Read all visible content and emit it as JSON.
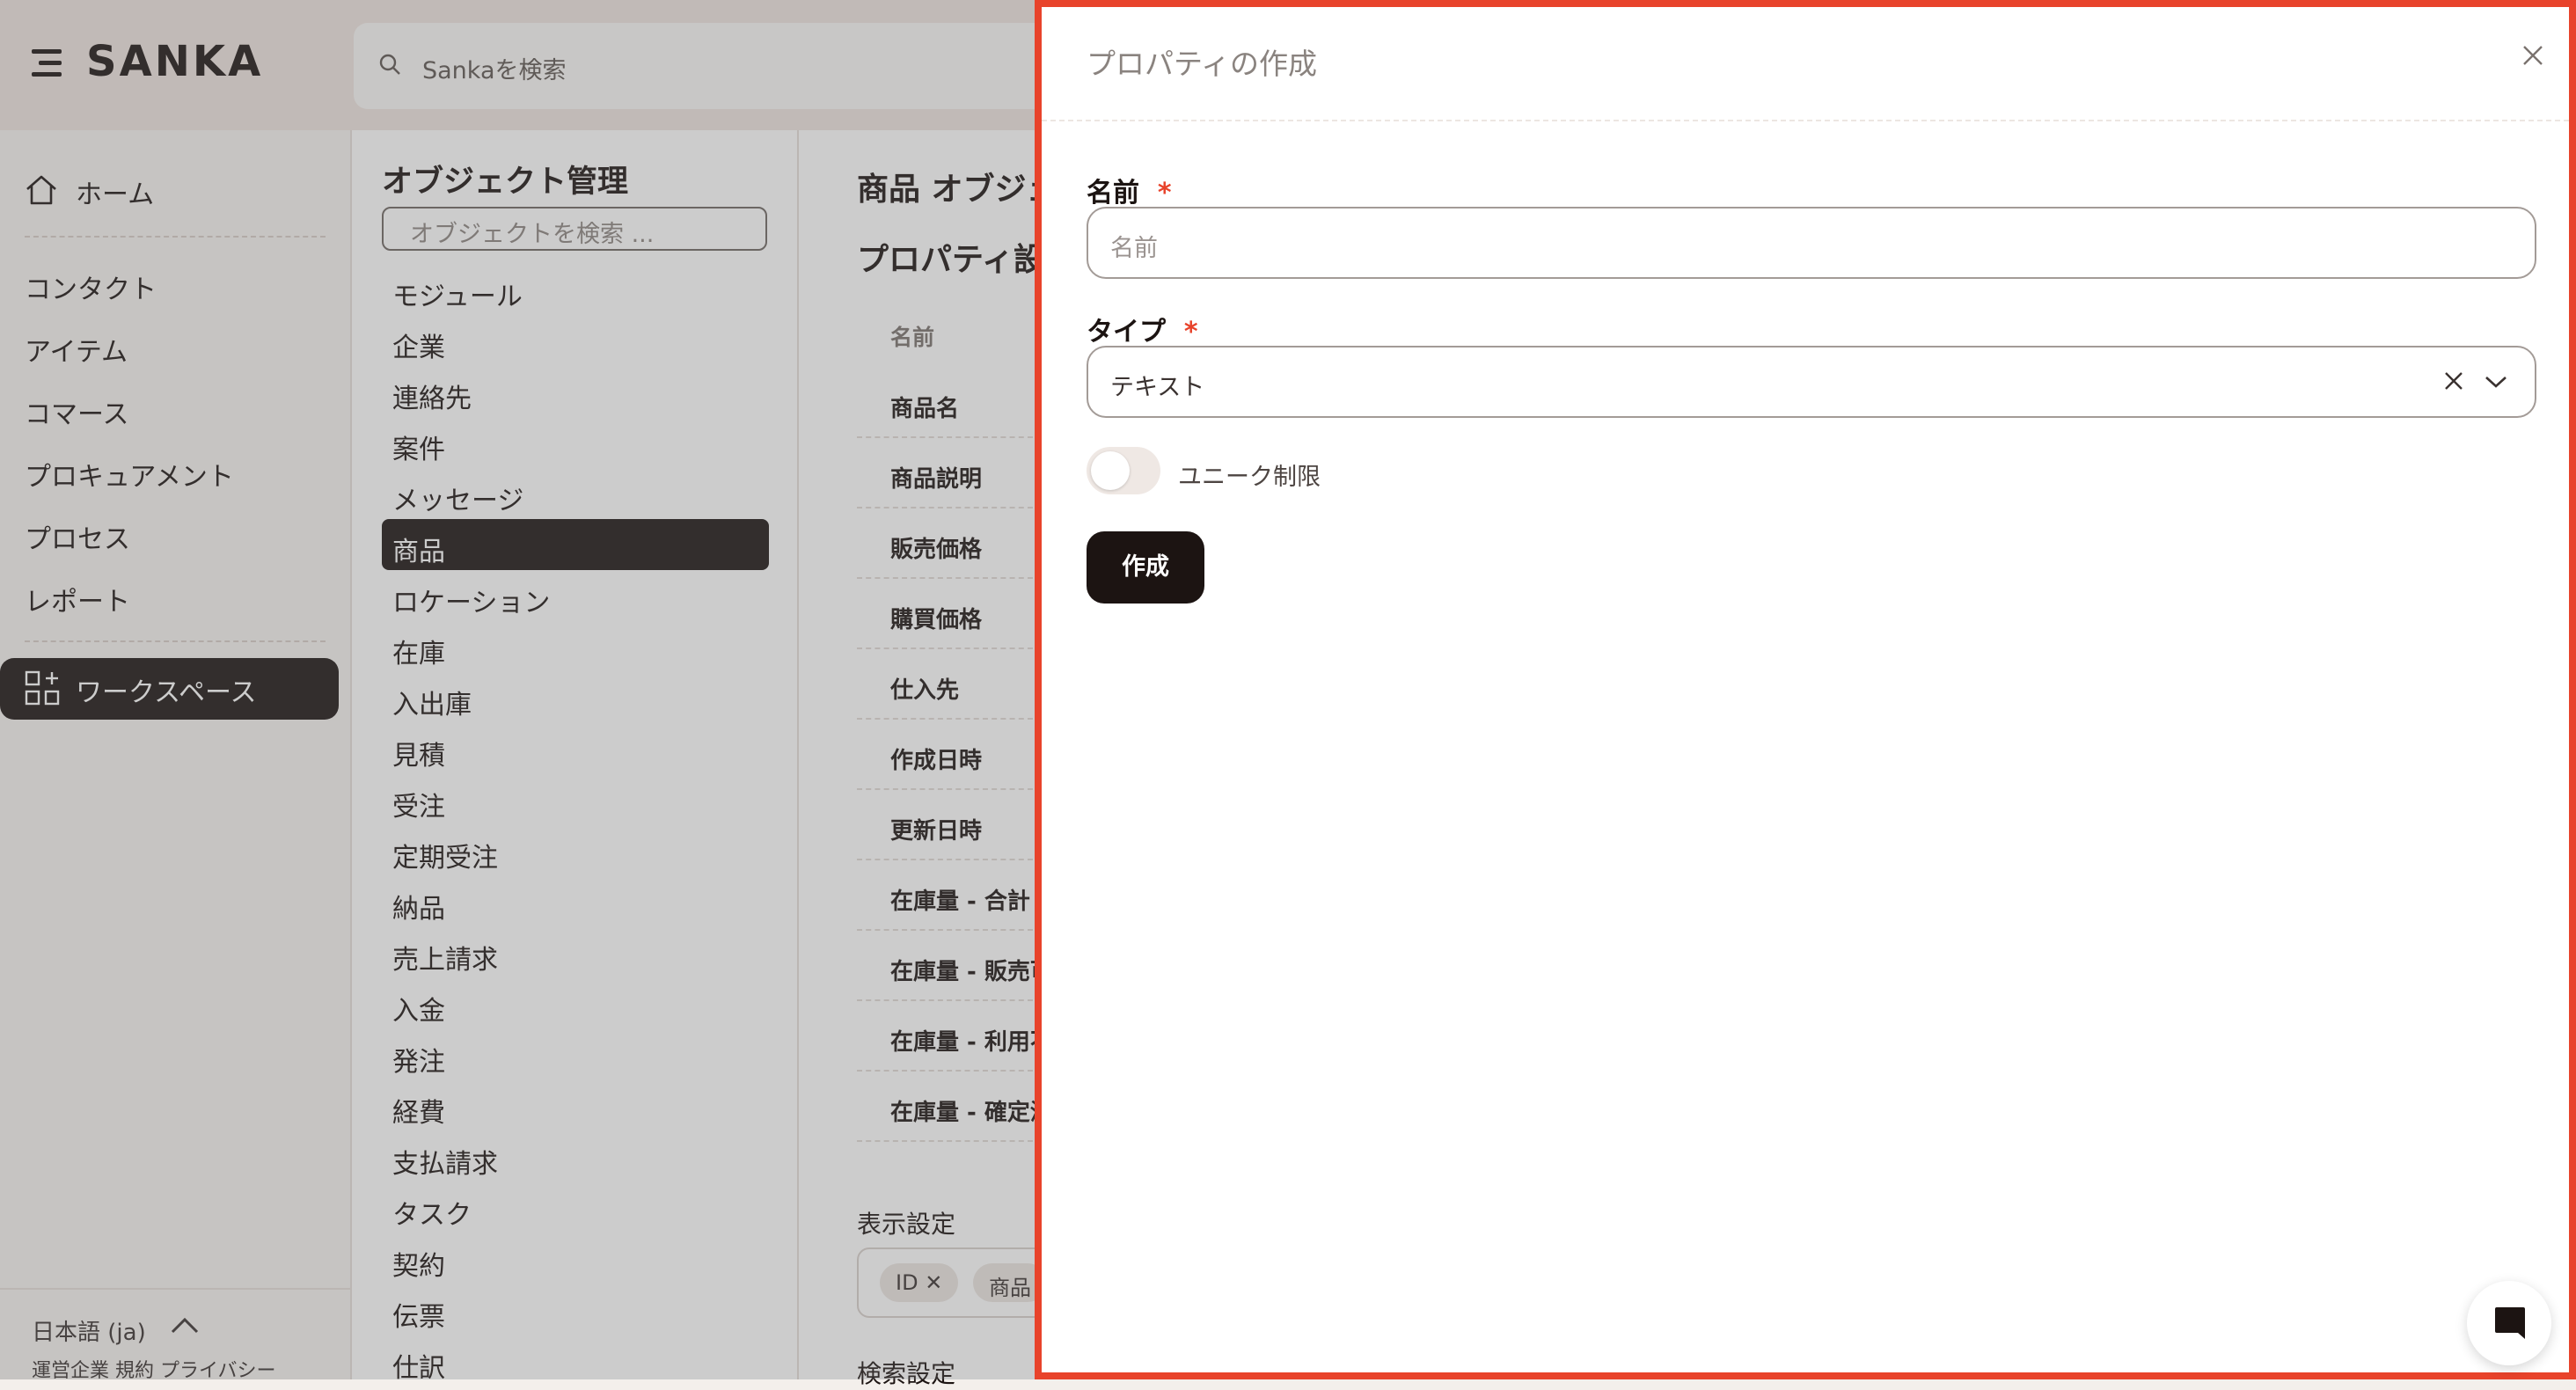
{
  "header": {
    "logo_text": "SANKA",
    "search_placeholder": "Sankaを検索"
  },
  "sidebar": {
    "home": "ホーム",
    "items": [
      "コンタクト",
      "アイテム",
      "コマース",
      "プロキュアメント",
      "プロセス",
      "レポート"
    ],
    "workspace": "ワークスペース",
    "language": "日本語 (ja)",
    "footer_links": "運営企業 規約 プライバシー"
  },
  "objects": {
    "title": "オブジェクト管理",
    "search_placeholder": "オブジェクトを検索 ...",
    "items": [
      "モジュール",
      "企業",
      "連絡先",
      "案件",
      "メッセージ",
      "商品",
      "ロケーション",
      "在庫",
      "入出庫",
      "見積",
      "受注",
      "定期受注",
      "納品",
      "売上請求",
      "入金",
      "発注",
      "経費",
      "支払請求",
      "タスク",
      "契約",
      "伝票",
      "仕訳"
    ],
    "active_index": 5
  },
  "main": {
    "title": "商品 オブジェ",
    "section": "プロパティ設",
    "column_header": "名前",
    "rows": [
      "商品名",
      "商品説明",
      "販売価格",
      "購買価格",
      "仕入先",
      "作成日時",
      "更新日時",
      "在庫量 - 合計",
      "在庫量 - 販売可",
      "在庫量 - 利用不",
      "在庫量 - 確定済"
    ],
    "display_settings": "表示設定",
    "chips": [
      "ID ✕",
      "商品"
    ],
    "search_settings": "検索設定"
  },
  "drawer": {
    "title": "プロパティの作成",
    "name_label": "名前",
    "required_mark": "*",
    "name_placeholder": "名前",
    "type_label": "タイプ",
    "type_value": "テキスト",
    "unique_label": "ユニーク制限",
    "unique_enabled": false,
    "create_button": "作成"
  },
  "colors": {
    "accent_border": "#e8432b",
    "dark": "#1c1412"
  }
}
